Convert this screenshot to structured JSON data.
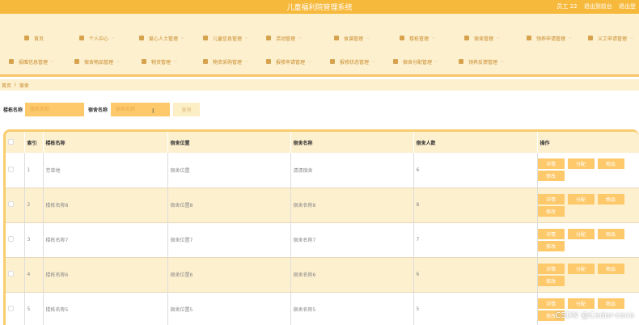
{
  "app": {
    "title": "儿童福利院管理系统"
  },
  "user": {
    "greeting": "员工 22",
    "back_label": "退出到前台",
    "logout_label": "退出登"
  },
  "nav": {
    "row1": [
      {
        "label": "首页",
        "chevron": false
      },
      {
        "label": "个人中心",
        "chevron": true
      },
      {
        "label": "爱心人士管理",
        "chevron": true
      },
      {
        "label": "儿童信息管理",
        "chevron": true
      },
      {
        "label": "活动管理",
        "chevron": true
      },
      {
        "label": "食谱管理",
        "chevron": true
      },
      {
        "label": "楼栋管理",
        "chevron": true
      },
      {
        "label": "宿舍管理",
        "chevron": true
      },
      {
        "label": "领养申请管理",
        "chevron": true
      },
      {
        "label": "义工申请管理",
        "chevron": true
      }
    ],
    "row2": [
      {
        "label": "捐赠信息管理",
        "chevron": true
      },
      {
        "label": "宿舍物品管理",
        "chevron": true
      },
      {
        "label": "物资管理",
        "chevron": true
      },
      {
        "label": "物资采购管理",
        "chevron": true
      },
      {
        "label": "报修申请管理",
        "chevron": true
      },
      {
        "label": "报修状态管理",
        "chevron": true
      },
      {
        "label": "宿舍分配管理",
        "chevron": true
      },
      {
        "label": "领养反馈管理",
        "chevron": true
      }
    ]
  },
  "breadcrumb": {
    "home": "首页",
    "sep": "I",
    "current": "宿舍"
  },
  "search": {
    "building_label": "楼栋名称",
    "building_placeholder": "楼栋名称",
    "dorm_label": "宿舍名称",
    "dorm_placeholder": "宿舍名称",
    "button_label": "查询"
  },
  "table": {
    "headers": [
      "索引",
      "楼栋名称",
      "宿舍位置",
      "宿舍名称",
      "宿舍人数",
      "操作"
    ],
    "rows": [
      {
        "index": "1",
        "building": "芳草地",
        "location": "宿舍位置",
        "name": "清清宿舍",
        "count": "6"
      },
      {
        "index": "2",
        "building": "楼栋名称8",
        "location": "宿舍位置8",
        "name": "宿舍名称8",
        "count": "8"
      },
      {
        "index": "3",
        "building": "楼栋名称7",
        "location": "宿舍位置7",
        "name": "宿舍名称7",
        "count": "7"
      },
      {
        "index": "4",
        "building": "楼栋名称6",
        "location": "宿舍位置6",
        "name": "宿舍名称6",
        "count": "6"
      },
      {
        "index": "5",
        "building": "楼栋名称5",
        "location": "宿舍位置5",
        "name": "宿舍名称5",
        "count": "5"
      }
    ],
    "actions": [
      "详情",
      "分配",
      "物品",
      "修改"
    ]
  },
  "watermark": "CSDN @Coder-coco",
  "colors": {
    "primary": "#f7b93c",
    "light": "#fdf0cf",
    "button": "#fdc96a"
  }
}
